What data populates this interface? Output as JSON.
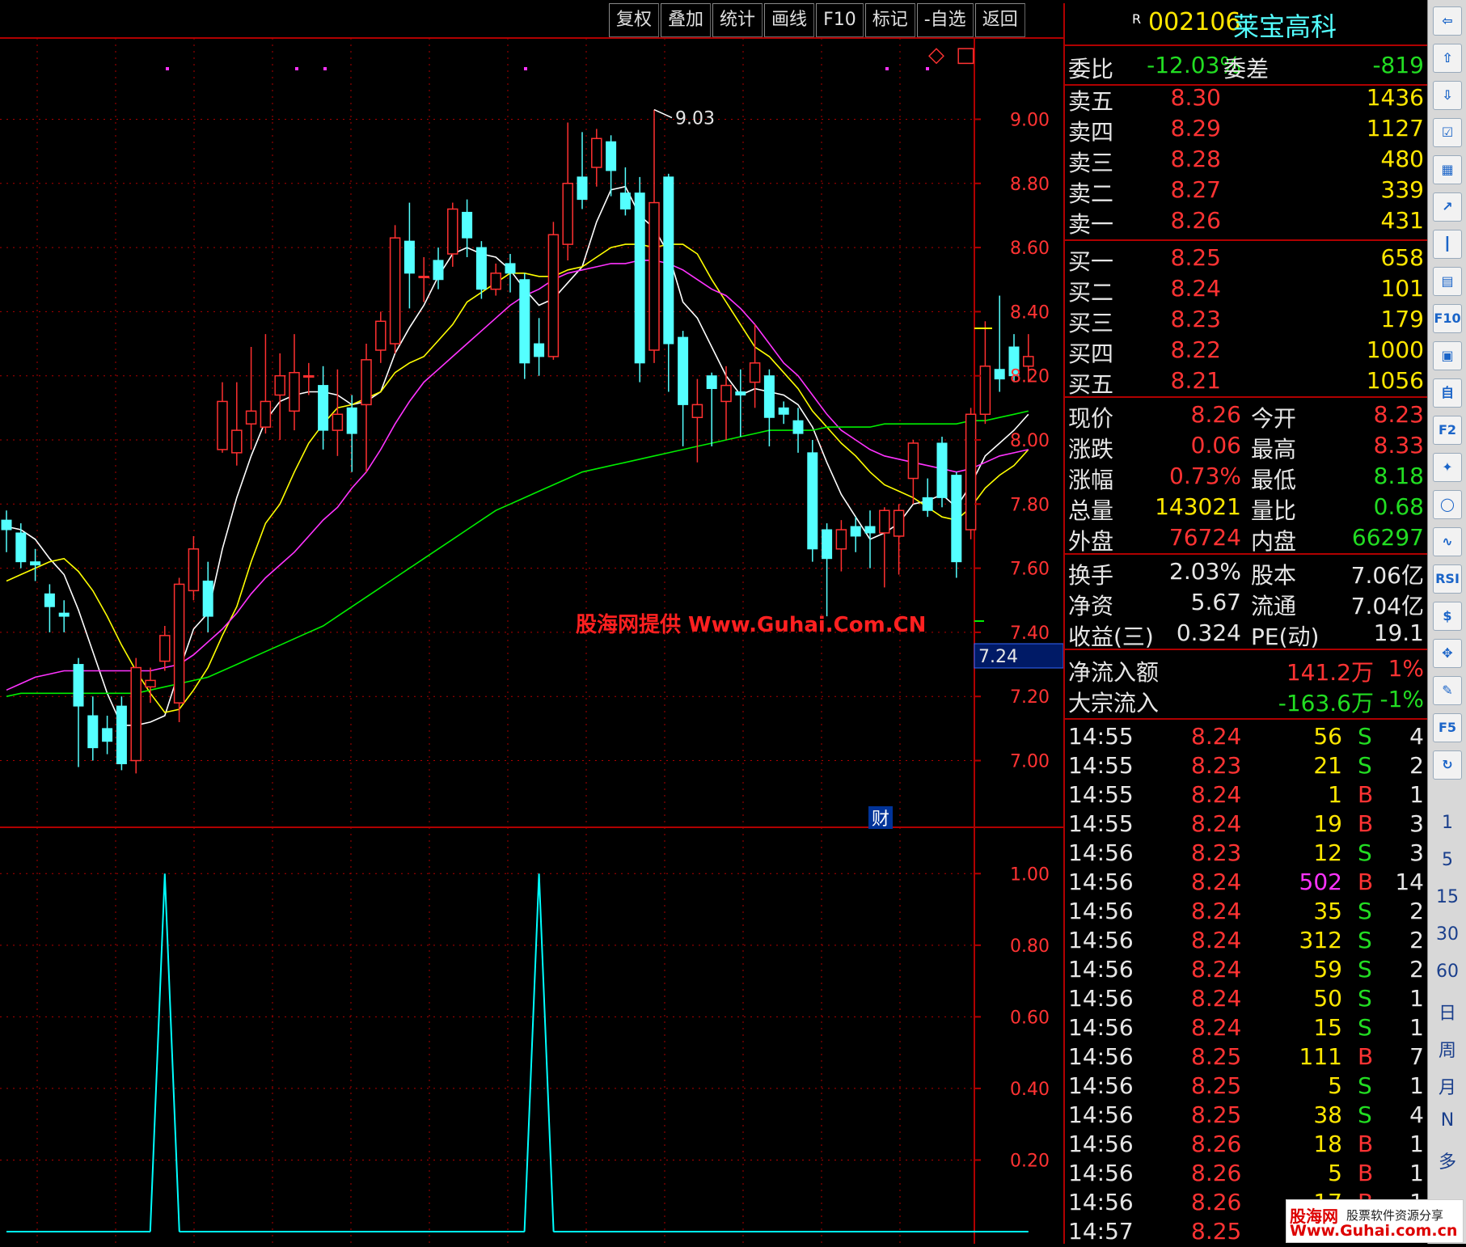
{
  "toolbar": {
    "buttons": [
      "复权",
      "叠加",
      "统计",
      "画线",
      "F10",
      "标记",
      "-自选",
      "返回"
    ]
  },
  "stock": {
    "badge": "R",
    "code": "002106",
    "name": "莱宝高科"
  },
  "order_book": {
    "weibi_label": "委比",
    "weibi_value": "-12.03%",
    "weicha_label": "委差",
    "weicha_value": "-819",
    "asks": [
      {
        "label": "卖五",
        "price": "8.30",
        "vol": "1436"
      },
      {
        "label": "卖四",
        "price": "8.29",
        "vol": "1127"
      },
      {
        "label": "卖三",
        "price": "8.28",
        "vol": "480"
      },
      {
        "label": "卖二",
        "price": "8.27",
        "vol": "339"
      },
      {
        "label": "卖一",
        "price": "8.26",
        "vol": "431"
      }
    ],
    "bids": [
      {
        "label": "买一",
        "price": "8.25",
        "vol": "658"
      },
      {
        "label": "买二",
        "price": "8.24",
        "vol": "101"
      },
      {
        "label": "买三",
        "price": "8.23",
        "vol": "179"
      },
      {
        "label": "买四",
        "price": "8.22",
        "vol": "1000"
      },
      {
        "label": "买五",
        "price": "8.21",
        "vol": "1056"
      }
    ]
  },
  "quote": [
    {
      "l1": "现价",
      "v1": "8.26",
      "c1": "red",
      "l2": "今开",
      "v2": "8.23",
      "c2": "red"
    },
    {
      "l1": "涨跌",
      "v1": "0.06",
      "c1": "red",
      "l2": "最高",
      "v2": "8.33",
      "c2": "red"
    },
    {
      "l1": "涨幅",
      "v1": "0.73%",
      "c1": "red",
      "l2": "最低",
      "v2": "8.18",
      "c2": "grn"
    },
    {
      "l1": "总量",
      "v1": "143021",
      "c1": "yel",
      "l2": "量比",
      "v2": "0.68",
      "c2": "grn"
    },
    {
      "l1": "外盘",
      "v1": "76724",
      "c1": "red",
      "l2": "内盘",
      "v2": "66297",
      "c2": "grn"
    }
  ],
  "fundamentals": [
    {
      "l1": "换手",
      "v1": "2.03%",
      "l2": "股本",
      "v2": "7.06亿"
    },
    {
      "l1": "净资",
      "v1": "5.67",
      "l2": "流通",
      "v2": "7.04亿"
    },
    {
      "l1": "收益(三)",
      "v1": "0.324",
      "l2": "PE(动)",
      "v2": "19.1"
    }
  ],
  "flows": [
    {
      "label": "净流入额",
      "value": "141.2万",
      "pct": "1%",
      "color": "red"
    },
    {
      "label": "大宗流入",
      "value": "-163.6万",
      "pct": "-1%",
      "color": "grn"
    }
  ],
  "ticks": [
    {
      "time": "14:55",
      "price": "8.24",
      "vol": "56",
      "side": "S",
      "n": "4"
    },
    {
      "time": "14:55",
      "price": "8.23",
      "vol": "21",
      "side": "S",
      "n": "2"
    },
    {
      "time": "14:55",
      "price": "8.24",
      "vol": "1",
      "side": "B",
      "n": "1"
    },
    {
      "time": "14:55",
      "price": "8.24",
      "vol": "19",
      "side": "B",
      "n": "3"
    },
    {
      "time": "14:56",
      "price": "8.23",
      "vol": "12",
      "side": "S",
      "n": "3"
    },
    {
      "time": "14:56",
      "price": "8.24",
      "vol": "502",
      "side": "B",
      "n": "14"
    },
    {
      "time": "14:56",
      "price": "8.24",
      "vol": "35",
      "side": "S",
      "n": "2"
    },
    {
      "time": "14:56",
      "price": "8.24",
      "vol": "312",
      "side": "S",
      "n": "2"
    },
    {
      "time": "14:56",
      "price": "8.24",
      "vol": "59",
      "side": "S",
      "n": "2"
    },
    {
      "time": "14:56",
      "price": "8.24",
      "vol": "50",
      "side": "S",
      "n": "1"
    },
    {
      "time": "14:56",
      "price": "8.24",
      "vol": "15",
      "side": "S",
      "n": "1"
    },
    {
      "time": "14:56",
      "price": "8.25",
      "vol": "111",
      "side": "B",
      "n": "7"
    },
    {
      "time": "14:56",
      "price": "8.25",
      "vol": "5",
      "side": "S",
      "n": "1"
    },
    {
      "time": "14:56",
      "price": "8.25",
      "vol": "38",
      "side": "S",
      "n": "4"
    },
    {
      "time": "14:56",
      "price": "8.26",
      "vol": "18",
      "side": "B",
      "n": "1"
    },
    {
      "time": "14:56",
      "price": "8.26",
      "vol": "5",
      "side": "B",
      "n": "1"
    },
    {
      "time": "14:56",
      "price": "8.26",
      "vol": "17",
      "side": "B",
      "n": "1"
    },
    {
      "time": "14:57",
      "price": "8.25",
      "vol": "",
      "side": "",
      "n": ""
    }
  ],
  "side_toolbar": {
    "icons": [
      "back-icon",
      "up-arrow-icon",
      "down-arrow-icon",
      "checklist-icon",
      "grid-icon",
      "chart-line-icon",
      "candle-icon",
      "news-icon",
      "f10-icon",
      "info-icon",
      "self-select-icon",
      "f2-icon",
      "compass-icon",
      "circle-icon",
      "chart-wave-icon",
      "rsi-icon",
      "dollar-icon",
      "move-icon",
      "pencil-icon",
      "f5-icon",
      "refresh-icon"
    ],
    "icon_labels": [
      "",
      "",
      "",
      "",
      "",
      "",
      "",
      "",
      "F10",
      "",
      "自",
      "F2",
      "",
      "",
      "",
      "RSI",
      "$",
      "",
      "",
      "F5",
      ""
    ],
    "periods": [
      "1",
      "5",
      "15",
      "30",
      "60",
      "日",
      "周",
      "月",
      "N",
      "多"
    ]
  },
  "watermark": "股海网提供 Www.Guhai.Com.CN",
  "bottom_logo": {
    "line1": "股海网",
    "line2": "股票软件资源分享",
    "line3": "Www.Guhai.com.cn"
  },
  "markers": {
    "high_label": "9.03",
    "fin_label": "财",
    "cur_price_tag": "7.24",
    "diamond": "◇",
    "square": "□"
  },
  "colors": {
    "up": "#ff3030",
    "down": "#54ffff",
    "ma1": "#ffffff",
    "ma2": "#ffff00",
    "ma3": "#ff33ff",
    "ma4": "#00ee00",
    "grid": "#b00000",
    "axis_text": "#ff3333"
  },
  "chart_data": [
    {
      "type": "candlestick",
      "ylim": [
        6.85,
        9.15
      ],
      "yticks": [
        "9.00",
        "8.80",
        "8.60",
        "8.40",
        "8.20",
        "8.00",
        "7.80",
        "7.60",
        "7.40",
        "7.20",
        "7.00"
      ],
      "candles": [
        [
          7.75,
          7.72,
          7.78,
          7.65
        ],
        [
          7.71,
          7.62,
          7.74,
          7.6
        ],
        [
          7.62,
          7.61,
          7.66,
          7.56
        ],
        [
          7.52,
          7.48,
          7.55,
          7.4
        ],
        [
          7.46,
          7.45,
          7.5,
          7.4
        ],
        [
          7.3,
          7.17,
          7.32,
          6.98
        ],
        [
          7.14,
          7.04,
          7.2,
          7.0
        ],
        [
          7.1,
          7.06,
          7.14,
          7.02
        ],
        [
          7.17,
          6.99,
          7.2,
          6.97
        ],
        [
          7.0,
          7.29,
          7.32,
          6.96
        ],
        [
          7.23,
          7.25,
          7.29,
          7.18
        ],
        [
          7.31,
          7.39,
          7.42,
          7.28
        ],
        [
          7.18,
          7.55,
          7.57,
          7.12
        ],
        [
          7.53,
          7.66,
          7.7,
          7.5
        ],
        [
          7.56,
          7.45,
          7.62,
          7.4
        ],
        [
          7.97,
          8.12,
          8.18,
          7.96
        ],
        [
          7.96,
          8.03,
          8.18,
          7.92
        ],
        [
          8.05,
          8.09,
          8.29,
          7.97
        ],
        [
          8.04,
          8.12,
          8.33,
          8.02
        ],
        [
          8.14,
          8.2,
          8.27,
          8.0
        ],
        [
          8.09,
          8.21,
          8.33,
          8.03
        ],
        [
          8.2,
          8.2,
          8.24,
          8.14
        ],
        [
          8.17,
          8.03,
          8.23,
          7.97
        ],
        [
          8.03,
          8.08,
          8.22,
          7.95
        ],
        [
          8.1,
          8.02,
          8.14,
          7.9
        ],
        [
          8.11,
          8.25,
          8.3,
          7.9
        ],
        [
          8.28,
          8.37,
          8.4,
          8.24
        ],
        [
          8.3,
          8.63,
          8.67,
          8.27
        ],
        [
          8.62,
          8.52,
          8.74,
          8.41
        ],
        [
          8.51,
          8.51,
          8.57,
          8.43
        ],
        [
          8.56,
          8.5,
          8.6,
          8.47
        ],
        [
          8.58,
          8.72,
          8.74,
          8.54
        ],
        [
          8.71,
          8.63,
          8.75,
          8.57
        ],
        [
          8.6,
          8.47,
          8.62,
          8.44
        ],
        [
          8.47,
          8.52,
          8.55,
          8.45
        ],
        [
          8.55,
          8.52,
          8.58,
          8.46
        ],
        [
          8.5,
          8.24,
          8.52,
          8.19
        ],
        [
          8.3,
          8.26,
          8.38,
          8.2
        ],
        [
          8.26,
          8.64,
          8.68,
          8.25
        ],
        [
          8.61,
          8.8,
          8.99,
          8.56
        ],
        [
          8.82,
          8.75,
          8.96,
          8.72
        ],
        [
          8.85,
          8.94,
          8.97,
          8.79
        ],
        [
          8.93,
          8.84,
          8.95,
          8.76
        ],
        [
          8.77,
          8.72,
          8.85,
          8.7
        ],
        [
          8.77,
          8.24,
          8.82,
          8.18
        ],
        [
          8.28,
          8.74,
          9.03,
          8.24
        ],
        [
          8.82,
          8.3,
          8.83,
          8.15
        ],
        [
          8.32,
          8.11,
          8.34,
          7.98
        ],
        [
          8.07,
          8.11,
          8.19,
          7.93
        ],
        [
          8.2,
          8.16,
          8.21,
          7.98
        ],
        [
          8.12,
          8.17,
          8.23,
          8.0
        ],
        [
          8.15,
          8.14,
          8.22,
          8.01
        ],
        [
          8.18,
          8.24,
          8.36,
          8.1
        ],
        [
          8.2,
          8.07,
          8.22,
          7.98
        ],
        [
          8.1,
          8.08,
          8.12,
          8.05
        ],
        [
          8.06,
          8.02,
          8.1,
          7.96
        ],
        [
          7.96,
          7.66,
          8.0,
          7.62
        ],
        [
          7.72,
          7.63,
          7.74,
          7.45
        ],
        [
          7.66,
          7.72,
          7.75,
          7.59
        ],
        [
          7.73,
          7.7,
          7.76,
          7.65
        ],
        [
          7.73,
          7.71,
          7.78,
          7.6
        ],
        [
          7.71,
          7.78,
          7.79,
          7.54
        ],
        [
          7.7,
          7.78,
          7.8,
          7.58
        ],
        [
          7.88,
          7.99,
          8.0,
          7.8
        ],
        [
          7.82,
          7.78,
          7.88,
          7.76
        ],
        [
          7.99,
          7.82,
          8.01,
          7.79
        ],
        [
          7.89,
          7.62,
          7.9,
          7.57
        ],
        [
          7.72,
          8.08,
          8.1,
          7.69
        ],
        [
          8.08,
          8.23,
          8.37,
          8.05
        ],
        [
          8.22,
          8.19,
          8.45,
          8.15
        ],
        [
          8.29,
          8.2,
          8.33,
          8.18
        ],
        [
          8.23,
          8.26,
          8.33,
          8.18
        ]
      ],
      "series": [
        {
          "name": "MA5",
          "color": "#ffffff",
          "values": [
            7.73,
            7.72,
            7.69,
            7.63,
            7.58,
            7.47,
            7.34,
            7.21,
            7.11,
            7.11,
            7.12,
            7.14,
            7.28,
            7.41,
            7.46,
            7.66,
            7.82,
            7.95,
            8.06,
            8.12,
            8.14,
            8.15,
            8.15,
            8.14,
            8.11,
            8.12,
            8.15,
            8.27,
            8.35,
            8.42,
            8.51,
            8.58,
            8.6,
            8.58,
            8.57,
            8.53,
            8.47,
            8.42,
            8.44,
            8.49,
            8.54,
            8.68,
            8.78,
            8.79,
            8.7,
            8.66,
            8.58,
            8.43,
            8.38,
            8.29,
            8.2,
            8.14,
            8.16,
            8.15,
            8.14,
            8.11,
            8.04,
            7.93,
            7.83,
            7.76,
            7.69,
            7.71,
            7.74,
            7.8,
            7.81,
            7.83,
            7.79,
            7.86,
            7.95,
            7.99,
            8.03,
            8.08
          ]
        },
        {
          "name": "MA10",
          "color": "#ffff00",
          "values": [
            7.56,
            7.58,
            7.6,
            7.62,
            7.63,
            7.59,
            7.53,
            7.45,
            7.36,
            7.28,
            7.21,
            7.15,
            7.16,
            7.22,
            7.29,
            7.39,
            7.48,
            7.62,
            7.74,
            7.8,
            7.9,
            7.99,
            8.05,
            8.1,
            8.11,
            8.13,
            8.15,
            8.21,
            8.24,
            8.26,
            8.31,
            8.36,
            8.43,
            8.46,
            8.49,
            8.52,
            8.52,
            8.51,
            8.51,
            8.53,
            8.54,
            8.57,
            8.6,
            8.61,
            8.61,
            8.6,
            8.61,
            8.61,
            8.58,
            8.5,
            8.43,
            8.36,
            8.29,
            8.26,
            8.21,
            8.16,
            8.09,
            8.04,
            7.99,
            7.95,
            7.9,
            7.86,
            7.84,
            7.82,
            7.79,
            7.76,
            7.75,
            7.79,
            7.85,
            7.89,
            7.92,
            7.97
          ]
        },
        {
          "name": "MA20",
          "color": "#ff33ff",
          "values": [
            7.22,
            7.24,
            7.26,
            7.27,
            7.28,
            7.28,
            7.28,
            7.28,
            7.28,
            7.28,
            7.28,
            7.29,
            7.3,
            7.33,
            7.37,
            7.41,
            7.46,
            7.52,
            7.57,
            7.61,
            7.65,
            7.7,
            7.75,
            7.79,
            7.85,
            7.9,
            7.97,
            8.05,
            8.12,
            8.18,
            8.22,
            8.26,
            8.3,
            8.34,
            8.38,
            8.42,
            8.45,
            8.47,
            8.5,
            8.52,
            8.53,
            8.54,
            8.55,
            8.55,
            8.56,
            8.56,
            8.55,
            8.53,
            8.5,
            8.47,
            8.45,
            8.41,
            8.36,
            8.3,
            8.24,
            8.2,
            8.14,
            8.08,
            8.03,
            8.0,
            7.97,
            7.95,
            7.94,
            7.93,
            7.92,
            7.91,
            7.9,
            7.91,
            7.93,
            7.95,
            7.96,
            7.97
          ]
        },
        {
          "name": "MA60",
          "color": "#00ee00",
          "values": [
            7.2,
            7.21,
            7.21,
            7.21,
            7.21,
            7.21,
            7.21,
            7.21,
            7.21,
            7.21,
            7.22,
            7.23,
            7.24,
            7.25,
            7.26,
            7.28,
            7.3,
            7.32,
            7.34,
            7.36,
            7.38,
            7.4,
            7.42,
            7.45,
            7.48,
            7.51,
            7.54,
            7.57,
            7.6,
            7.63,
            7.66,
            7.69,
            7.72,
            7.75,
            7.78,
            7.8,
            7.82,
            7.84,
            7.86,
            7.88,
            7.9,
            7.91,
            7.92,
            7.93,
            7.94,
            7.95,
            7.96,
            7.97,
            7.98,
            7.99,
            8.0,
            8.01,
            8.02,
            8.03,
            8.03,
            8.03,
            8.03,
            8.04,
            8.04,
            8.04,
            8.04,
            8.05,
            8.05,
            8.05,
            8.05,
            8.05,
            8.05,
            8.06,
            8.06,
            8.07,
            8.08,
            8.09
          ]
        }
      ]
    },
    {
      "type": "line",
      "ylim": [
        0,
        1.1
      ],
      "yticks": [
        "1.00",
        "0.80",
        "0.60",
        "0.40",
        "0.20"
      ],
      "series": [
        {
          "color": "#00ffff",
          "values": [
            0,
            0,
            0,
            0,
            0,
            0,
            0,
            0,
            0,
            0,
            0,
            1,
            0,
            0,
            0,
            0,
            0,
            0,
            0,
            0,
            0,
            0,
            0,
            0,
            0,
            0,
            0,
            0,
            0,
            0,
            0,
            0,
            0,
            0,
            0,
            0,
            0,
            1,
            0,
            0,
            0,
            0,
            0,
            0,
            0,
            0,
            0,
            0,
            0,
            0,
            0,
            0,
            0,
            0,
            0,
            0,
            0,
            0,
            0,
            0,
            0,
            0,
            0,
            0,
            0,
            0,
            0,
            0,
            0,
            0,
            0,
            0
          ]
        }
      ]
    }
  ]
}
